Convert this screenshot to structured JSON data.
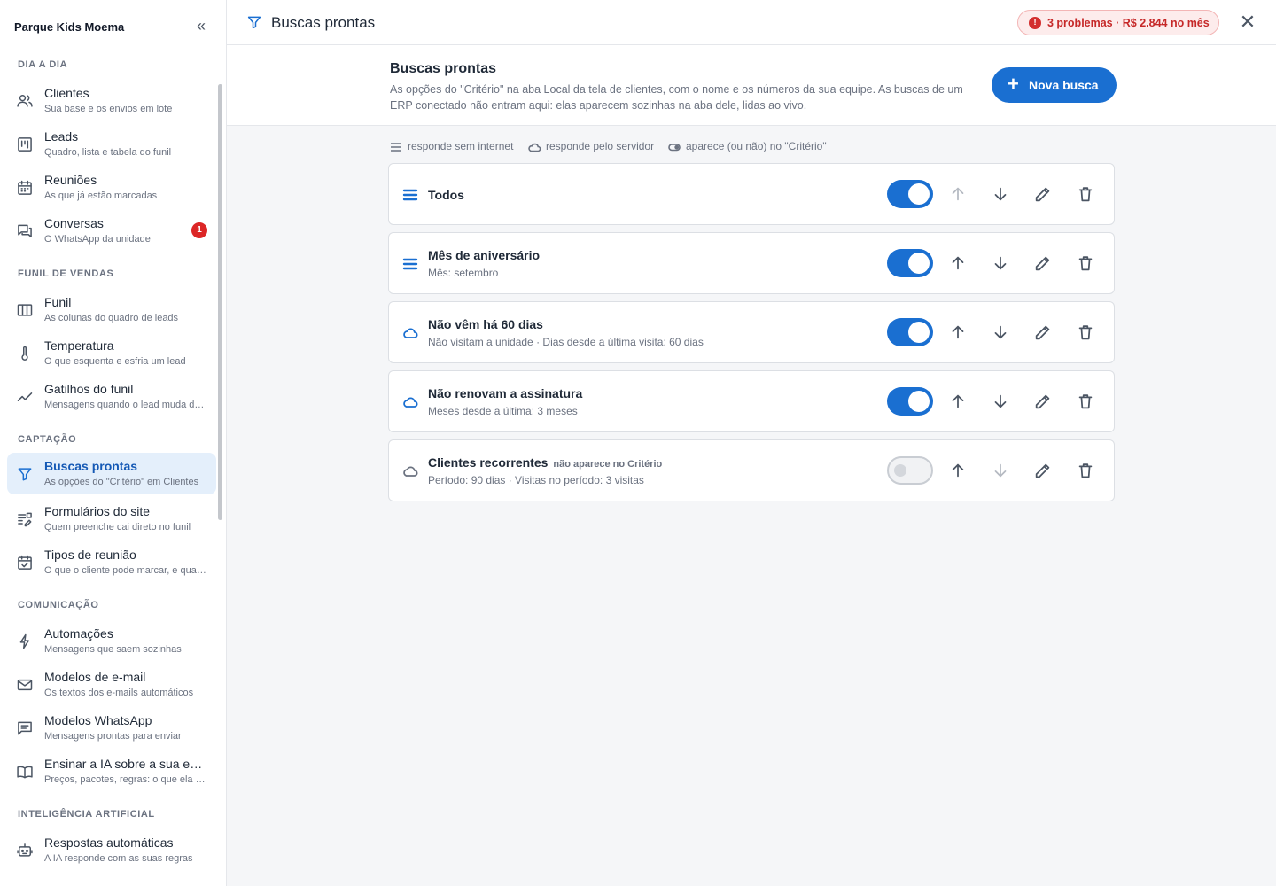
{
  "sidebar": {
    "title": "Parque Kids Moema",
    "sections": [
      {
        "label": "DIA A DIA"
      },
      {
        "label": "FUNIL DE VENDAS"
      },
      {
        "label": "CAPTAÇÃO"
      },
      {
        "label": "COMUNICAÇÃO"
      },
      {
        "label": "INTELIGÊNCIA ARTIFICIAL"
      }
    ],
    "items": [
      {
        "label": "Clientes",
        "sub": "Sua base e os envios em lote",
        "icon": "users-icon"
      },
      {
        "label": "Leads",
        "sub": "Quadro, lista e tabela do funil",
        "icon": "kanban-icon"
      },
      {
        "label": "Reuniões",
        "sub": "As que já estão marcadas",
        "icon": "calendar-icon"
      },
      {
        "label": "Conversas",
        "sub": "O WhatsApp da unidade",
        "icon": "chat-icon",
        "badge": "1"
      },
      {
        "label": "Funil",
        "sub": "As colunas do quadro de leads",
        "icon": "columns-icon"
      },
      {
        "label": "Temperatura",
        "sub": "O que esquenta e esfria um lead",
        "icon": "thermometer-icon"
      },
      {
        "label": "Gatilhos do funil",
        "sub": "Mensagens quando o lead muda de etapa",
        "icon": "trend-icon"
      },
      {
        "label": "Buscas prontas",
        "sub": "As opções do \"Critério\" em Clientes",
        "icon": "filter-icon",
        "active": true
      },
      {
        "label": "Formulários do site",
        "sub": "Quem preenche cai direto no funil",
        "icon": "form-icon"
      },
      {
        "label": "Tipos de reunião",
        "sub": "O que o cliente pode marcar, e quando",
        "icon": "calendar-check-icon"
      },
      {
        "label": "Automações",
        "sub": "Mensagens que saem sozinhas",
        "icon": "bolt-icon"
      },
      {
        "label": "Modelos de e-mail",
        "sub": "Os textos dos e-mails automáticos",
        "icon": "mail-icon"
      },
      {
        "label": "Modelos WhatsApp",
        "sub": "Mensagens prontas para enviar",
        "icon": "message-icon"
      },
      {
        "label": "Ensinar a IA sobre a sua empresa",
        "sub": "Preços, pacotes, regras: o que ela precisa saber",
        "icon": "book-icon"
      },
      {
        "label": "Respostas automáticas",
        "sub": "A IA responde com as suas regras",
        "icon": "robot-icon"
      }
    ]
  },
  "topbar": {
    "title": "Buscas prontas",
    "alert": "3 problemas · R$ 2.844 no mês",
    "alert_icon": "!"
  },
  "intro": {
    "title": "Buscas prontas",
    "description": "As opções do \"Critério\" na aba Local da tela de clientes, com o nome e os números da sua equipe. As buscas de um ERP conectado não entram aqui: elas aparecem sozinhas na aba dele, lidas ao vivo.",
    "new_button": "Nova busca"
  },
  "legend": {
    "offline": "responde sem internet",
    "server": "responde pelo servidor",
    "toggle": "aparece (ou não) no \"Critério\""
  },
  "searches": [
    {
      "name": "Todos",
      "desc": "",
      "kind": "list-icon",
      "enabled": true,
      "tag": ""
    },
    {
      "name": "Mês de aniversário",
      "desc": "Mês: setembro",
      "kind": "list-icon",
      "enabled": true,
      "tag": ""
    },
    {
      "name": "Não vêm há 60 dias",
      "desc": "Não visitam a unidade · Dias desde a última visita: 60 dias",
      "kind": "cloud-icon",
      "enabled": true,
      "tag": ""
    },
    {
      "name": "Não renovam a assinatura",
      "desc": "Meses desde a última: 3 meses",
      "kind": "cloud-icon",
      "enabled": true,
      "tag": ""
    },
    {
      "name": "Clientes recorrentes",
      "desc": "Período: 90 dias · Visitas no período: 3 visitas",
      "kind": "cloud-icon",
      "enabled": false,
      "tag": "não aparece no Critério"
    }
  ],
  "colors": {
    "accent": "#1a6fd1",
    "alert_text": "#c62828",
    "alert_bg": "#fdecec",
    "badge": "#dc2626"
  }
}
